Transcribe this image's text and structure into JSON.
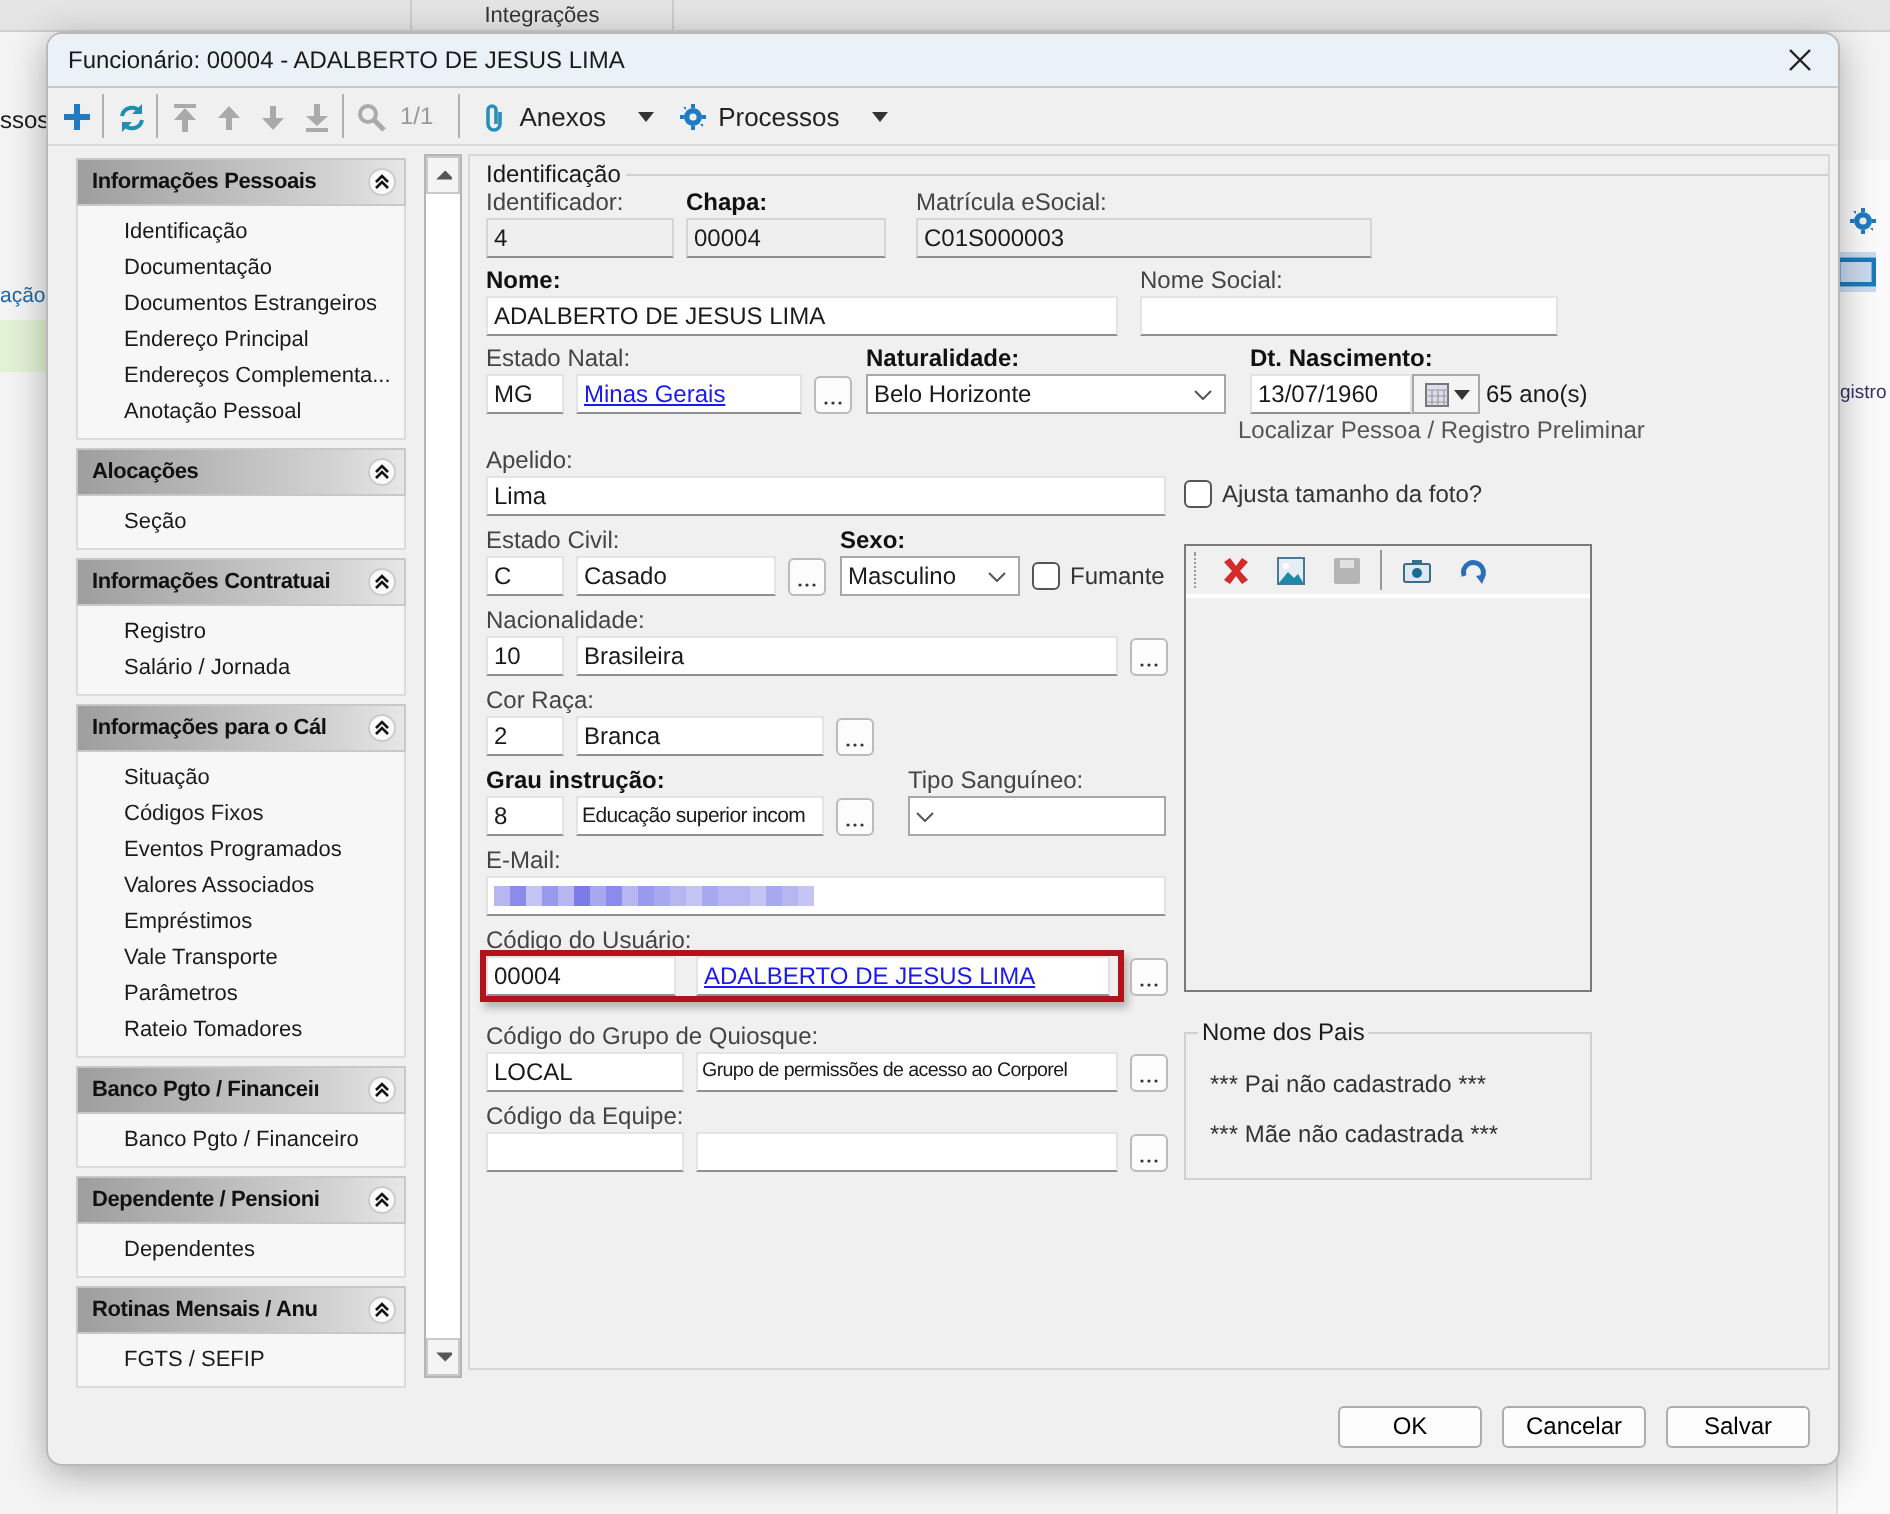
{
  "background": {
    "tab": "Integrações",
    "left_texts": [
      "ssos",
      "ação"
    ],
    "right_text": "gistro"
  },
  "dialog": {
    "title": "Funcionário: 00004 - ADALBERTO DE JESUS LIMA",
    "toolbar": {
      "record_counter": "1/1",
      "menus": [
        "Anexos",
        "Processos"
      ]
    },
    "sidebar": [
      {
        "title": "Informações Pessoais",
        "expanded": true,
        "items": [
          "Identificação",
          "Documentação",
          "Documentos Estrangeiros",
          "Endereço Principal",
          "Endereços Complementa...",
          "Anotação Pessoal"
        ]
      },
      {
        "title": "Alocações",
        "expanded": true,
        "items": [
          "Seção"
        ]
      },
      {
        "title": "Informações Contratuai",
        "expanded": true,
        "items": [
          "Registro",
          "Salário / Jornada"
        ]
      },
      {
        "title": "Informações para o Cál",
        "expanded": true,
        "items": [
          "Situação",
          "Códigos Fixos",
          "Eventos Programados",
          "Valores Associados",
          "Empréstimos",
          "Vale Transporte",
          "Parâmetros",
          "Rateio Tomadores"
        ]
      },
      {
        "title": "Banco Pgto / Financeiı",
        "expanded": true,
        "items": [
          "Banco Pgto / Financeiro"
        ]
      },
      {
        "title": "Dependente / Pensioni",
        "expanded": true,
        "items": [
          "Dependentes"
        ]
      },
      {
        "title": "Rotinas Mensais / Anu",
        "expanded": true,
        "items": [
          "FGTS / SEFIP"
        ]
      }
    ],
    "section_title": "Identificação",
    "fields": {
      "identificador": {
        "label": "Identificador:",
        "required": false,
        "readonly": true,
        "value": "4"
      },
      "chapa": {
        "label": "Chapa:",
        "required": true,
        "readonly": true,
        "value": "00004"
      },
      "matricula": {
        "label": "Matrícula eSocial:",
        "required": false,
        "readonly": true,
        "value": "C01S000003"
      },
      "nome": {
        "label": "Nome:",
        "required": true,
        "readonly": false,
        "value": "ADALBERTO DE JESUS LIMA"
      },
      "nome_social": {
        "label": "Nome Social:",
        "required": false,
        "readonly": false
      },
      "estado_natal": {
        "label": "Estado Natal:",
        "required": false,
        "code": "MG",
        "value": "Minas Gerais",
        "link": true
      },
      "naturalidade": {
        "label": "Naturalidade:",
        "required": true,
        "value": "Belo Horizonte"
      },
      "nascimento": {
        "label": "Dt. Nascimento:",
        "required": true,
        "value": "13/07/1960",
        "age": "65 ano(s)",
        "link_text": "Localizar Pessoa / Registro Preliminar"
      },
      "apelido": {
        "label": "Apelido:",
        "required": false,
        "readonly": false,
        "value": "Lima"
      },
      "ajusta_foto": {
        "label": "Ajusta tamanho da foto?",
        "checked": false
      },
      "estado_civil": {
        "label": "Estado Civil:",
        "required": false,
        "code": "C",
        "value": "Casado",
        "link": false
      },
      "sexo": {
        "label": "Sexo:",
        "required": true,
        "value": "Masculino"
      },
      "fumante": {
        "label": "Fumante",
        "checked": false
      },
      "nacionalidade": {
        "label": "Nacionalidade:",
        "required": false,
        "code": "10",
        "value": "Brasileira",
        "link": false
      },
      "cor_raca": {
        "label": "Cor Raça:",
        "required": false,
        "code": "2",
        "value": "Branca",
        "link": false
      },
      "grau_instrucao": {
        "label": "Grau instrução:",
        "required": true,
        "code": "8",
        "value": "Educação superior incom",
        "link": false
      },
      "tipo_sanguineo": {
        "label": "Tipo Sanguíneo:",
        "required": false
      },
      "email": {
        "label": "E-Mail:",
        "required": false
      },
      "codigo_usuario": {
        "label": "Código do Usuário:",
        "required": false,
        "code": "00004",
        "value": "ADALBERTO DE JESUS LIMA",
        "link": true,
        "highlighted": true
      },
      "grupo_quiosque": {
        "label": "Código do Grupo de Quiosque:",
        "required": false,
        "code": "LOCAL",
        "value": "Grupo de permissões de acesso ao Corporel",
        "link": false
      },
      "equipe": {
        "label": "Código da Equipe:",
        "required": false
      }
    },
    "parents": {
      "title": "Nome dos Pais",
      "lines": [
        "*** Pai não cadastrado ***",
        "*** Mãe não cadastrada ***"
      ]
    },
    "buttons": [
      "OK",
      "Cancelar",
      "Salvar"
    ]
  }
}
